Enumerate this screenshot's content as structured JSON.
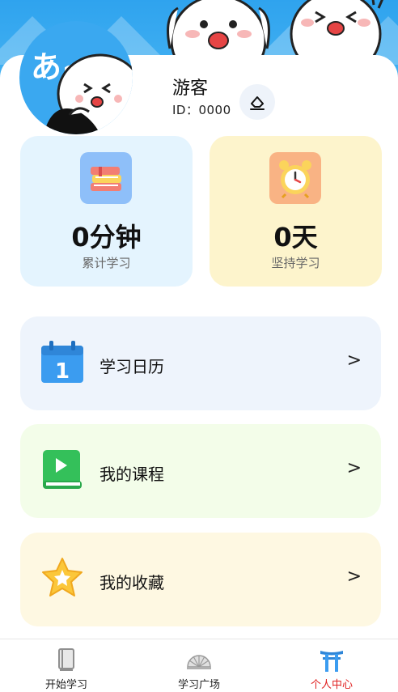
{
  "profile": {
    "username": "游客",
    "id_text": "ID：0000",
    "avatar_text": "あ~"
  },
  "stats": [
    {
      "value": "0分钟",
      "label": "累计学习",
      "icon": "books-icon"
    },
    {
      "value": "0天",
      "label": "坚持学习",
      "icon": "alarm-clock-icon"
    }
  ],
  "menu": [
    {
      "label": "学习日历",
      "icon": "calendar-icon",
      "arrow": ">"
    },
    {
      "label": "我的课程",
      "icon": "video-book-icon",
      "arrow": ">"
    },
    {
      "label": "我的收藏",
      "icon": "star-icon",
      "arrow": ">"
    }
  ],
  "tabs": [
    {
      "label": "开始学习",
      "icon": "book-icon",
      "active": false
    },
    {
      "label": "学习广场",
      "icon": "fan-icon",
      "active": false
    },
    {
      "label": "个人中心",
      "icon": "torii-icon",
      "active": true
    }
  ],
  "colors": {
    "header_blue": "#2fa3ee",
    "active_tab": "#e02020",
    "calendar_card": "#eef4fc",
    "course_card": "#f3fde9",
    "favorite_card": "#fef8e2"
  }
}
